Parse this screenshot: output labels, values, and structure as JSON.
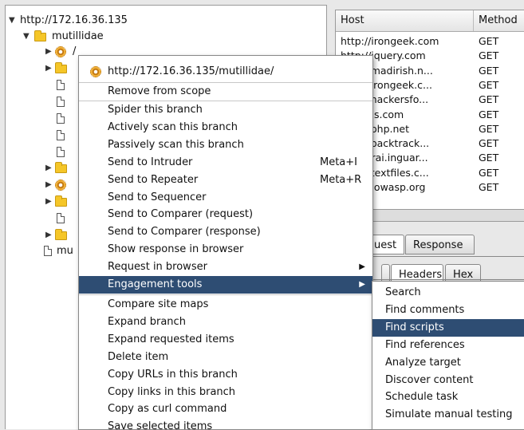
{
  "tree": {
    "root_label": "http://172.16.36.135",
    "folder_label": "mutillidae",
    "slash_label": "/",
    "bottom_label": "mu"
  },
  "history": {
    "columns": {
      "host": "Host",
      "method": "Method"
    },
    "rows": [
      {
        "host": "http://irongeek.com",
        "method": "GET"
      },
      {
        "host": "http://jquery.com",
        "method": "GET"
      },
      {
        "host": "/www.madirish.n...",
        "method": "GET"
      },
      {
        "host": "/www.irongeek.c...",
        "method": "GET"
      },
      {
        "host": "/www.hackersfo...",
        "method": "GET"
      },
      {
        "host": "/sizzlejs.com",
        "method": "GET"
      },
      {
        "host": "/www.php.net",
        "method": "GET"
      },
      {
        "host": "/www.backtrack...",
        "method": "GET"
      },
      {
        "host": "/samurai.inguar...",
        "method": "GET"
      },
      {
        "host": "/www.textfiles.c...",
        "method": "GET"
      },
      {
        "host": "//www.owasp.org",
        "method": "GET"
      }
    ]
  },
  "tabs": {
    "request": "uest",
    "response": "Response",
    "raw": "",
    "headers": "Headers",
    "hex": "Hex"
  },
  "context_menu": {
    "header": "http://172.16.36.135/mutillidae/",
    "remove_scope": "Remove from scope",
    "items": [
      {
        "label": "Spider this branch"
      },
      {
        "label": "Actively scan this branch"
      },
      {
        "label": "Passively scan this branch"
      },
      {
        "label": "Send to Intruder",
        "accel": "Meta+I"
      },
      {
        "label": "Send to Repeater",
        "accel": "Meta+R"
      },
      {
        "label": "Send to Sequencer"
      },
      {
        "label": "Send to Comparer (request)"
      },
      {
        "label": "Send to Comparer (response)"
      },
      {
        "label": "Show response in browser"
      },
      {
        "label": "Request in browser",
        "submenu": true
      },
      {
        "label": "Engagement tools",
        "submenu": true,
        "highlighted": true
      }
    ],
    "items2": [
      {
        "label": "Compare site maps"
      },
      {
        "label": "Expand branch"
      },
      {
        "label": "Expand requested items"
      },
      {
        "label": "Delete item"
      },
      {
        "label": "Copy URLs in this branch"
      },
      {
        "label": "Copy links in this branch"
      },
      {
        "label": "Copy as curl command"
      },
      {
        "label": "Save selected items"
      }
    ]
  },
  "submenu": {
    "items": [
      {
        "label": "Search"
      },
      {
        "label": "Find comments"
      },
      {
        "label": "Find scripts",
        "highlighted": true
      },
      {
        "label": "Find references"
      },
      {
        "label": "Analyze target"
      },
      {
        "label": "Discover content"
      },
      {
        "label": "Schedule task"
      },
      {
        "label": "Simulate manual testing"
      }
    ]
  },
  "colors": {
    "highlight": "#2e4d73",
    "folder": "#f5c628"
  },
  "icons": [
    "tree-expanded-arrow",
    "tree-collapsed-arrow",
    "folder-icon",
    "file-icon",
    "gear-icon",
    "submenu-arrow-icon"
  ]
}
